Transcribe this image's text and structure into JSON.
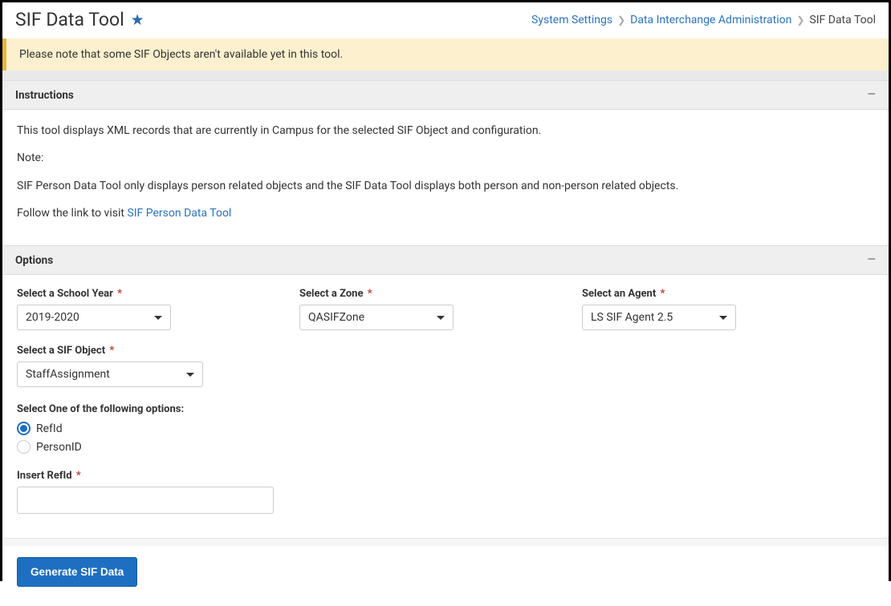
{
  "header": {
    "title": "SIF Data Tool",
    "breadcrumb": {
      "link1": "System Settings",
      "link2": "Data Interchange Administration",
      "current": "SIF Data Tool"
    }
  },
  "alert": {
    "text": "Please note that some SIF Objects aren't available yet in this tool."
  },
  "instructions": {
    "header": "Instructions",
    "intro": "This tool displays XML records that are currently in Campus for the selected SIF Object and configuration.",
    "note_label": "Note:",
    "note_text": "SIF Person Data Tool only displays person related objects and the SIF Data Tool displays both person and non-person related objects.",
    "follow_prefix": "Follow the link to visit ",
    "follow_link": "SIF Person Data Tool"
  },
  "options": {
    "header": "Options",
    "school_year": {
      "label": "Select a School Year",
      "value": "2019-2020"
    },
    "zone": {
      "label": "Select a Zone",
      "value": "QASIFZone"
    },
    "agent": {
      "label": "Select an Agent",
      "value": "LS SIF Agent 2.5"
    },
    "sif_object": {
      "label": "Select a SIF Object",
      "value": "StaffAssignment"
    },
    "radio_label": "Select One of the following options:",
    "radio_refid": "RefId",
    "radio_personid": "PersonID",
    "refid_input_label": "Insert RefId",
    "refid_value": ""
  },
  "actions": {
    "generate": "Generate SIF Data"
  }
}
